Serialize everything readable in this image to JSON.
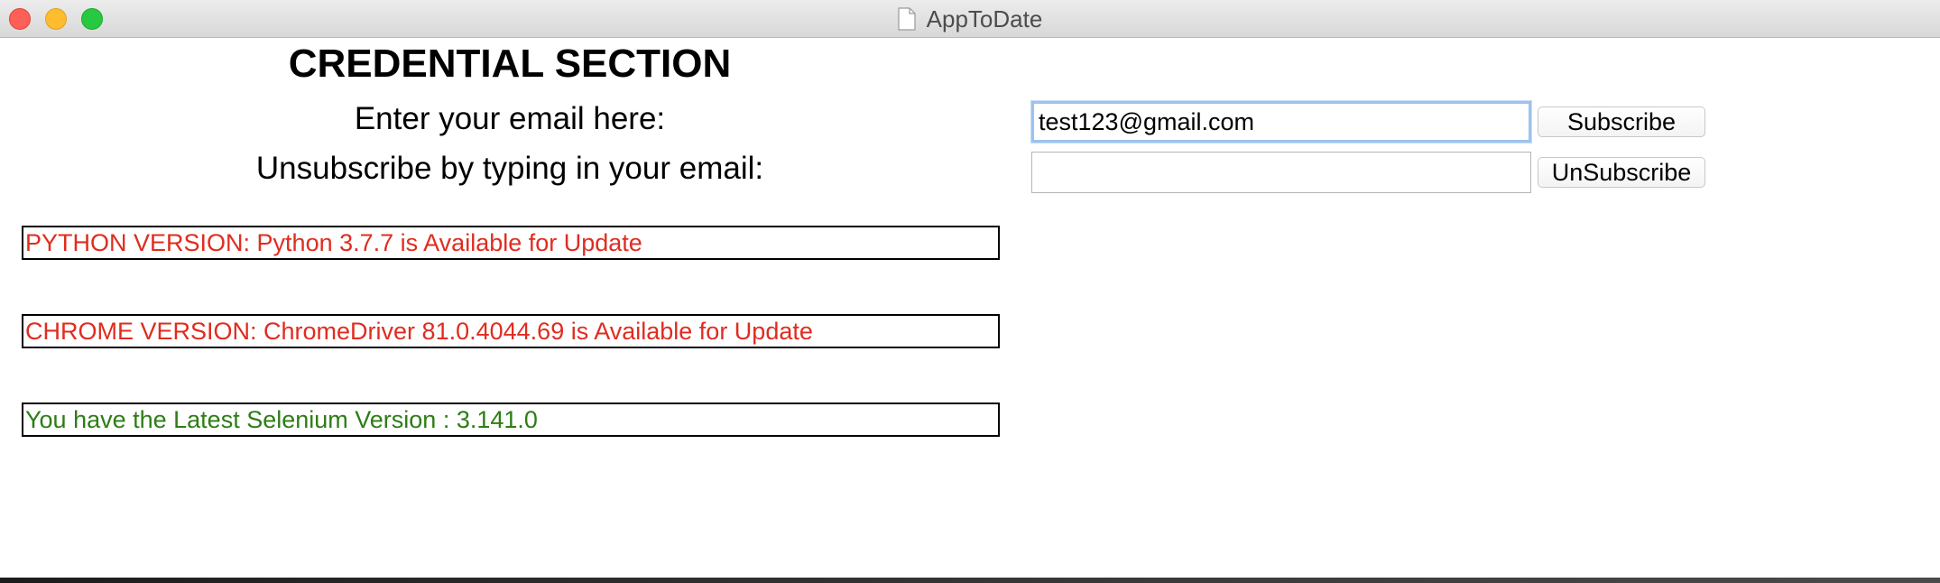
{
  "window": {
    "title": "AppToDate"
  },
  "credentials": {
    "heading": "CREDENTIAL SECTION",
    "email_label": "Enter your email here:",
    "unsubscribe_label": "Unsubscribe by typing in your email:",
    "email_value": "test123@gmail.com",
    "unsubscribe_value": "",
    "subscribe_button": "Subscribe",
    "unsubscribe_button": "UnSubscribe"
  },
  "status": {
    "python": "PYTHON VERSION: Python 3.7.7 is Available for Update",
    "chrome": "CHROME VERSION: ChromeDriver 81.0.4044.69 is Available for Update",
    "selenium": "You have the Latest Selenium Version : 3.141.0"
  },
  "colors": {
    "update_available": "#e02c1f",
    "up_to_date": "#2d7d15",
    "focus_ring": "#9cc3ee"
  },
  "icons": {
    "title_icon": "document-icon"
  }
}
